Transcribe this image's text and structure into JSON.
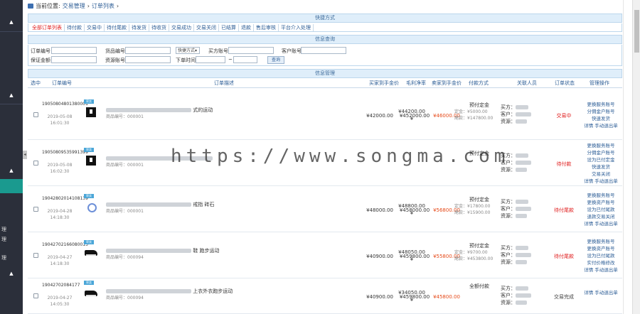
{
  "breadcrumb": {
    "prefix": "当前位置:",
    "items": [
      "交易管理",
      "订单列表"
    ],
    "separator": "›"
  },
  "sidebar": {
    "labels": [
      "理",
      "理",
      "理"
    ]
  },
  "sections": {
    "filter_title": "快捷方式",
    "search_title": "信息查询",
    "list_title": "信息管理"
  },
  "quick_filters": [
    {
      "label": "全部订单列表",
      "active": true
    },
    {
      "label": "待付款",
      "active": false
    },
    {
      "label": "交易中",
      "active": false
    },
    {
      "label": "待付尾款",
      "active": false
    },
    {
      "label": "待发货",
      "active": false
    },
    {
      "label": "待收货",
      "active": false
    },
    {
      "label": "交易成功",
      "active": false
    },
    {
      "label": "交易关闭",
      "active": false
    },
    {
      "label": "已结算",
      "active": false
    },
    {
      "label": "退款",
      "active": false
    },
    {
      "label": "售后审核",
      "active": false
    },
    {
      "label": "平台介入处理",
      "active": false
    }
  ],
  "search": {
    "order_no_label": "订单编号",
    "goods_no_label": "货品编号",
    "status_select": "快捷方式",
    "buyer_no_label": "买方账号",
    "customer_label": "客户账号",
    "deposit_label": "保证金额",
    "resource_label": "资源账号",
    "order_time_label": "下单时间",
    "range_sep": "~",
    "search_button": "查询"
  },
  "table": {
    "headers": {
      "check": "选中",
      "order_no": "订单编号",
      "desc": "订单描述",
      "buy_price": "买家到手金价",
      "gross": "毛利净率",
      "sell_price": "卖家到手金价",
      "pay": "付款方式",
      "people": "关联人员",
      "status": "订单状态",
      "ops": "管理操作"
    },
    "rows": [
      {
        "order_no": "19050804801380001",
        "date": "2019-05-08",
        "time": "16:01:30",
        "badge": "寄卖",
        "thumb": "jersey",
        "desc_tail": "式的运动",
        "code": "商品编号：000001",
        "buy": "¥42000.00",
        "gross": "¥44200.00",
        "gross_unit": "¥",
        "sell": "¥452000.00",
        "sell_red": "¥46000.00",
        "pay_type": "预付定金",
        "pay_a": "定金：¥5000.00",
        "pay_b": "尾款：¥147800.00",
        "people": [
          "买方：",
          "客户：",
          "资源："
        ],
        "status": "交易中",
        "status_color": "red",
        "ops": [
          "更换服务账号",
          "分佣金户账号",
          "快速发货",
          "详情 手动退出单"
        ]
      },
      {
        "order_no": "19050809535991399",
        "date": "2019-05-08",
        "time": "16:02:30",
        "badge": "寄卖",
        "thumb": "jersey",
        "desc_tail": "",
        "code": "商品编号：000001",
        "buy": "",
        "gross": "",
        "gross_unit": "",
        "sell": "",
        "sell_red": "",
        "pay_type": "预付定金",
        "pay_a": "",
        "pay_b": "",
        "people": [
          "买方：",
          "客户：",
          "资源："
        ],
        "status": "待付款",
        "status_color": "red",
        "ops": [
          "更换服务账号",
          "分佣金户账号",
          "设为已付定金",
          "快速发货",
          "交易关闭",
          "详情 手动退出单"
        ]
      },
      {
        "order_no": "19042802014108139",
        "date": "2019-04-28",
        "time": "14:18:30",
        "badge": "寄卖",
        "thumb": "ring",
        "desc_tail": "戒指 砖石",
        "code": "商品编号：000001",
        "buy": "¥48000.00",
        "gross": "¥48800.00",
        "gross_unit": "¥",
        "sell": "¥458000.00",
        "sell_red": "¥56800.00",
        "pay_type": "预付定金",
        "pay_a": "定金：¥17800.00",
        "pay_b": "尾款：¥15900.00",
        "people": [
          "买方：",
          "客户：",
          "资源："
        ],
        "status": "待付尾款",
        "status_color": "red",
        "ops": [
          "更换服务账号",
          "更换资产账号",
          "设为已付尾款",
          "退款交易关闭",
          "详情 手动退出单"
        ]
      },
      {
        "order_no": "19042702166080015",
        "date": "2019-04-27",
        "time": "14:18:30",
        "badge": "寄卖",
        "thumb": "shoe-b",
        "desc_tail": "鞋 跑步运动",
        "code": "商品编号：000094",
        "buy": "¥40900.00",
        "gross": "¥48050.00",
        "gross_unit": "¥",
        "sell": "¥459800.00",
        "sell_red": "¥55800.00",
        "pay_type": "预付定金",
        "pay_a": "定金：¥9700.00",
        "pay_b": "尾款：¥453800.00",
        "people": [
          "买方：",
          "客户：",
          "资源："
        ],
        "status": "待付尾款",
        "status_color": "red",
        "ops": [
          "更换服务账号",
          "更换资产账号",
          "设为已付尾款",
          "实付价格修改",
          "详情 手动退出单"
        ]
      },
      {
        "order_no": "19042702084177",
        "date": "2019-04-27",
        "time": "14:05:30",
        "badge": "寄卖",
        "thumb": "shoe-b",
        "desc_tail": "上衣外衣跑步运动",
        "code": "商品编号：000094",
        "buy": "¥40900.00",
        "gross": "¥34050.00",
        "gross_unit": "¥",
        "sell": "¥459800.00",
        "sell_red": "¥45800.00",
        "pay_type": "全额付款",
        "pay_a": "",
        "pay_b": "",
        "people": [
          "买方：",
          "客户：",
          "资源："
        ],
        "status": "交易完成",
        "status_color": "gray",
        "ops": [
          "",
          "详情 手动退出单"
        ]
      }
    ]
  },
  "watermark": "https://www.songma.com"
}
